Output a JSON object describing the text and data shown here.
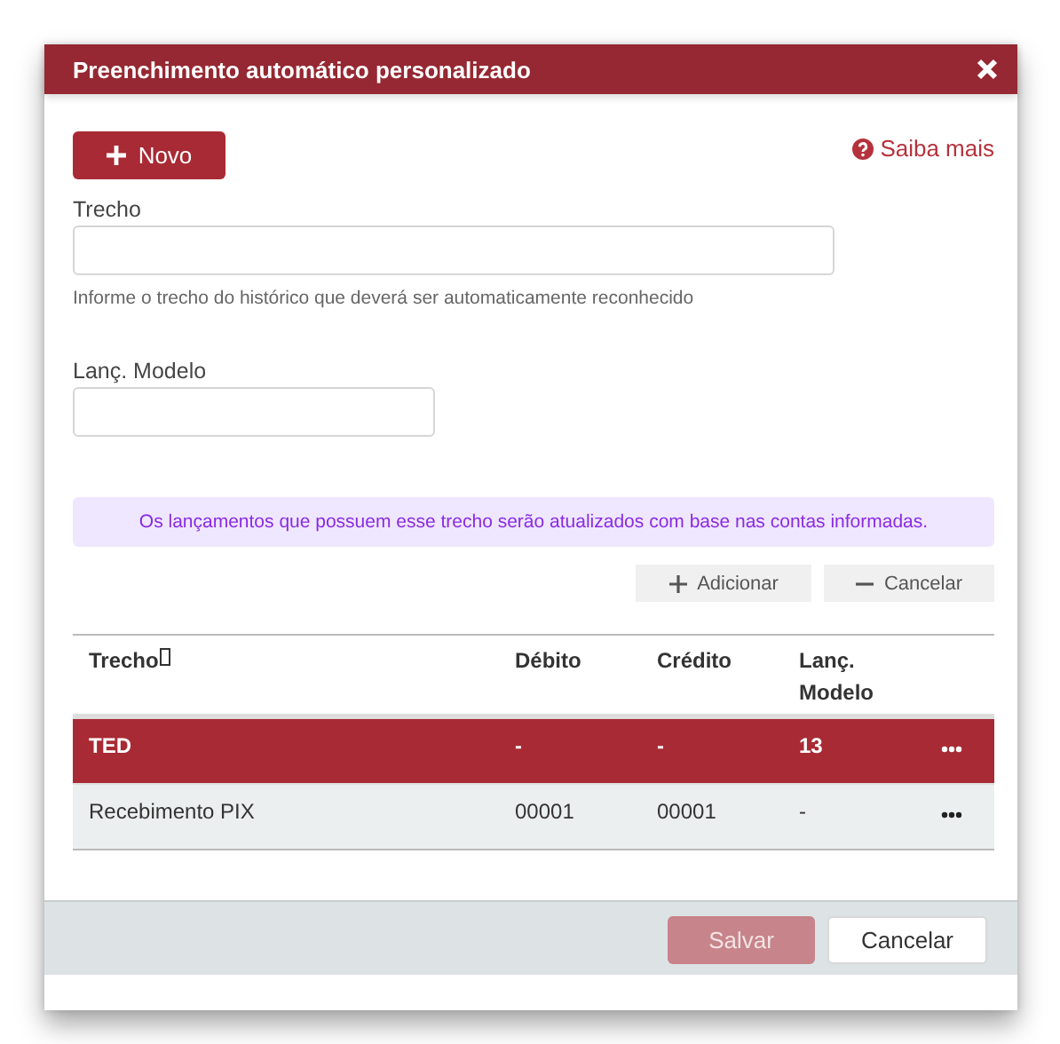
{
  "dialog": {
    "title": "Preenchimento automático personalizado"
  },
  "toolbar": {
    "new_button": "Novo",
    "help_link": "Saiba mais"
  },
  "fields": [
    {
      "label": "Trecho",
      "hint": "Informe o trecho do histórico que deverá ser automaticamente reconhecido",
      "kind": "wide"
    },
    {
      "label": "Lanç. Modelo",
      "kind": "narrow"
    }
  ],
  "info": "Os lançamentos que possuem esse trecho serão atualizados com base nas contas informadas.",
  "actions": [
    {
      "kind": "add",
      "label": "Adicionar"
    },
    {
      "kind": "remove",
      "label": "Cancelar"
    }
  ],
  "table": {
    "columns": [
      "Trecho",
      "Débito",
      "Crédito",
      "Lanç. Modelo"
    ],
    "rows": [
      {
        "cells": [
          "TED",
          "-",
          "-",
          "13"
        ],
        "selected": true
      },
      {
        "cells": [
          "Recebimento PIX",
          "00001",
          "00001",
          "-"
        ],
        "selected": false
      }
    ]
  },
  "footer": [
    {
      "label": "Salvar",
      "kind": "primary",
      "disabled": true
    },
    {
      "label": "Cancelar",
      "kind": "secondary",
      "disabled": false
    }
  ]
}
